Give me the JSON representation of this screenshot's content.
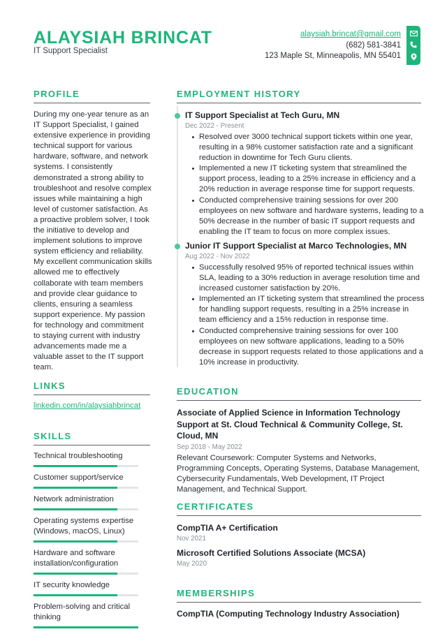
{
  "header": {
    "name": "ALAYSIAH BRINCAT",
    "title": "IT Support Specialist",
    "email": "alaysiah.brincat@gmail.com",
    "phone": "(682) 581-3841",
    "address": "123 Maple St, Minneapolis, MN 55401",
    "icons": [
      "envelope-icon",
      "phone-icon",
      "map-pin-icon"
    ]
  },
  "colors": {
    "accent": "#1db57b",
    "text": "#2b2f36",
    "muted": "#8a8f96",
    "rule": "#5b6068",
    "bar_track": "#e3e5e8"
  },
  "profile": {
    "heading": "PROFILE",
    "text": "During my one-year tenure as an IT Support Specialist, I gained extensive experience in providing technical support for various hardware, software, and network systems. I consistently demonstrated a strong ability to troubleshoot and resolve complex issues while maintaining a high level of customer satisfaction. As a proactive problem solver, I took the initiative to develop and implement solutions to improve system efficiency and reliability. My excellent communication skills allowed me to effectively collaborate with team members and provide clear guidance to clients, ensuring a seamless support experience. My passion for technology and commitment to staying current with industry advancements made me a valuable asset to the IT support team."
  },
  "links": {
    "heading": "LINKS",
    "items": [
      "linkedin.com/in/alaysiahbrincat"
    ]
  },
  "skills": {
    "heading": "SKILLS",
    "items": [
      {
        "label": "Technical troubleshooting",
        "level": 0.8
      },
      {
        "label": "Customer support/service",
        "level": 0.8
      },
      {
        "label": "Network administration",
        "level": 0.8
      },
      {
        "label": "Operating systems expertise (Windows, macOS, Linux)",
        "level": 0.8
      },
      {
        "label": "Hardware and software installation/configuration",
        "level": 0.8
      },
      {
        "label": "IT security knowledge",
        "level": 0.8
      },
      {
        "label": "Problem-solving and critical thinking",
        "level": 1.0
      }
    ]
  },
  "employment": {
    "heading": "EMPLOYMENT HISTORY",
    "jobs": [
      {
        "title": "IT Support Specialist at Tech Guru, MN",
        "date": "Dec 2022 - Present",
        "bullets": [
          "Resolved over 3000 technical support tickets within one year, resulting in a 98% customer satisfaction rate and a significant reduction in downtime for Tech Guru clients.",
          "Implemented a new IT ticketing system that streamlined the support process, leading to a 25% increase in efficiency and a 20% reduction in average response time for support requests.",
          "Conducted comprehensive training sessions for over 200 employees on new software and hardware systems, leading to a 50% decrease in the number of basic IT support requests and enabling the IT team to focus on more complex issues."
        ]
      },
      {
        "title": "Junior IT Support Specialist at Marco Technologies, MN",
        "date": "Aug 2022 - Nov 2022",
        "bullets": [
          "Successfully resolved 95% of reported technical issues within SLA, leading to a 30% reduction in average resolution time and increased customer satisfaction by 20%.",
          "Implemented an IT ticketing system that streamlined the process for handling support requests, resulting in a 25% increase in team efficiency and a 15% reduction in response time.",
          "Conducted comprehensive training sessions for over 100 employees on new software applications, leading to a 50% decrease in support requests related to those applications and a 10% increase in productivity."
        ]
      }
    ]
  },
  "education": {
    "heading": "EDUCATION",
    "items": [
      {
        "title": "Associate of Applied Science in Information Technology Support at St. Cloud Technical & Community College, St. Cloud, MN",
        "date": "Sep 2018 - May 2022",
        "text": "Relevant Coursework: Computer Systems and Networks, Programming Concepts, Operating Systems, Database Management, Cybersecurity Fundamentals, Web Development, IT Project Management, and Technical Support."
      }
    ]
  },
  "certificates": {
    "heading": "CERTIFICATES",
    "items": [
      {
        "title": "CompTIA A+ Certification",
        "date": "Nov 2021"
      },
      {
        "title": "Microsoft Certified Solutions Associate (MCSA)",
        "date": "May 2020"
      }
    ]
  },
  "memberships": {
    "heading": "MEMBERSHIPS",
    "items": [
      "CompTIA (Computing Technology Industry Association)"
    ]
  }
}
